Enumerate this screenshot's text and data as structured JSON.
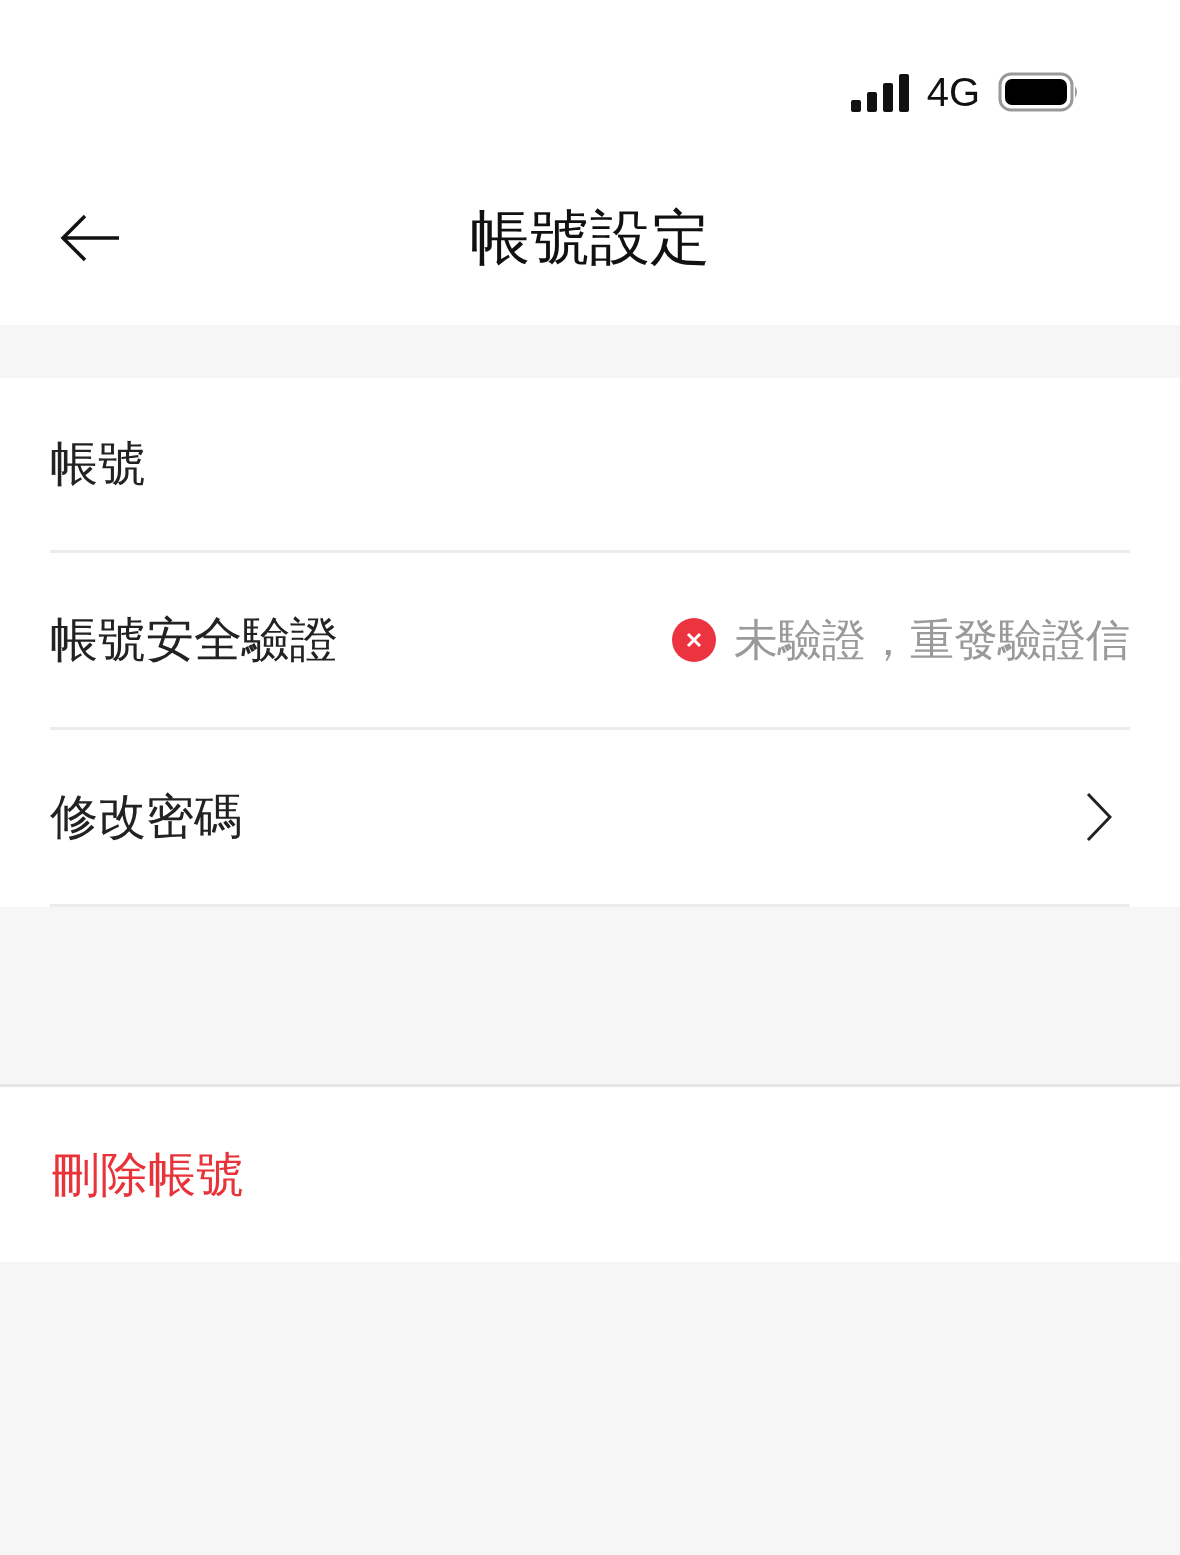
{
  "status_bar": {
    "network": "4G"
  },
  "header": {
    "title": "帳號設定"
  },
  "rows": [
    {
      "kind": "plain",
      "label": "帳號"
    },
    {
      "kind": "status",
      "label": "帳號安全驗證",
      "verified": false,
      "value": "未驗證，重發驗證信"
    },
    {
      "kind": "link",
      "label": "修改密碼"
    }
  ],
  "danger_action": {
    "label": "刪除帳號"
  }
}
